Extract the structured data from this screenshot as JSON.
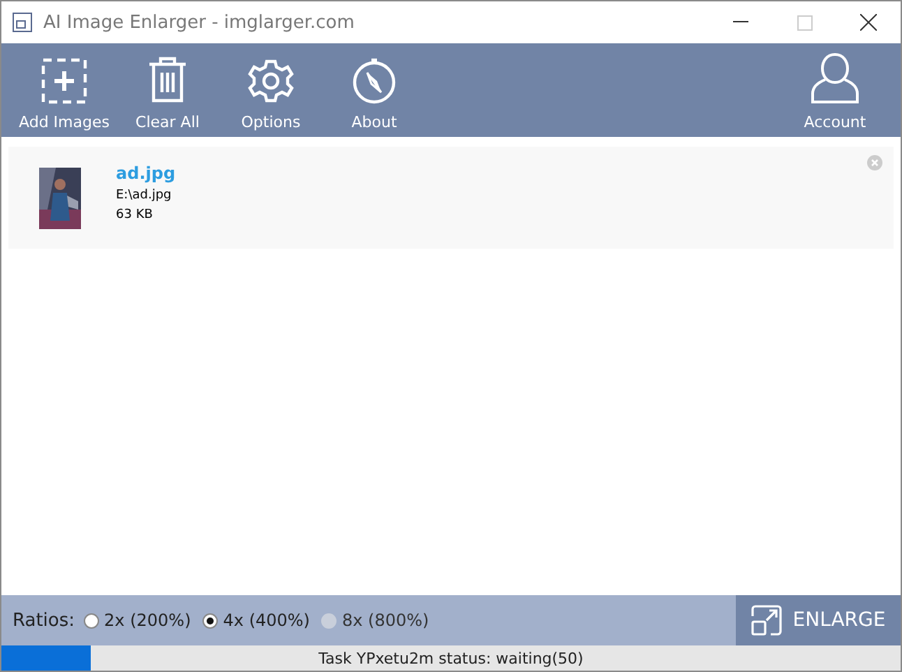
{
  "window": {
    "title": "AI Image Enlarger - imglarger.com"
  },
  "toolbar": [
    {
      "kind": "add",
      "label": "Add Images"
    },
    {
      "kind": "trash",
      "label": "Clear All"
    },
    {
      "kind": "gear",
      "label": "Options"
    },
    {
      "kind": "compass",
      "label": "About"
    }
  ],
  "account": {
    "label": "Account"
  },
  "files": [
    {
      "name": "ad.jpg",
      "path": "E:\\ad.jpg",
      "size": "63 KB"
    }
  ],
  "ratios": {
    "label": "Ratios:",
    "options": [
      {
        "label": "2x (200%)",
        "selected": false,
        "disabled": false
      },
      {
        "label": "4x (400%)",
        "selected": true,
        "disabled": false
      },
      {
        "label": "8x (800%)",
        "selected": false,
        "disabled": true
      }
    ]
  },
  "enlarge_button": "ENLARGE",
  "status": {
    "level": 0.1,
    "text": "Task YPxetu2m status: waiting(50)"
  }
}
